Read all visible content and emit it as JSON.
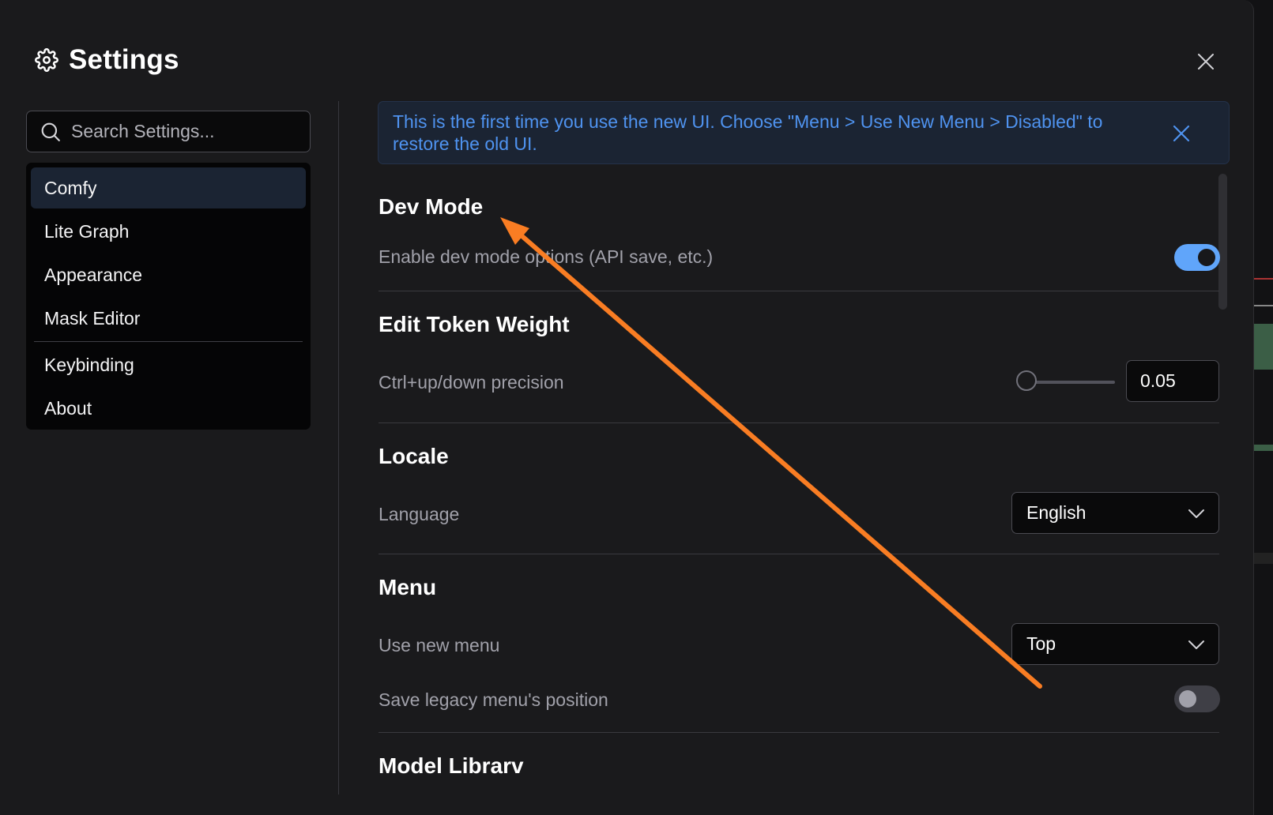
{
  "dialog": {
    "title": "Settings",
    "title_icon": "gear-icon",
    "close_icon": "close-icon"
  },
  "sidebar": {
    "search_placeholder": "Search Settings...",
    "search_icon": "search-icon",
    "items": [
      {
        "label": "Comfy",
        "active": true
      },
      {
        "label": "Lite Graph",
        "active": false
      },
      {
        "label": "Appearance",
        "active": false
      },
      {
        "label": "Mask Editor",
        "active": false
      },
      {
        "label": "Keybinding",
        "active": false
      },
      {
        "label": "About",
        "active": false
      }
    ]
  },
  "banner": {
    "message": "This is the first time you use the new UI. Choose \"Menu > Use New Menu > Disabled\" to restore the old UI.",
    "close_icon": "close-icon",
    "color": "#4f93f0"
  },
  "sections": {
    "dev_mode": {
      "title": "Dev Mode",
      "enable_label": "Enable dev mode options (API save, etc.)",
      "enabled": true
    },
    "edit_token_weight": {
      "title": "Edit Token Weight",
      "precision_label": "Ctrl+up/down precision",
      "precision_value": "0.05",
      "slider_fraction": 0.0
    },
    "locale": {
      "title": "Locale",
      "language_label": "Language",
      "language_value": "English"
    },
    "menu": {
      "title": "Menu",
      "use_new_menu_label": "Use new menu",
      "use_new_menu_value": "Top",
      "save_legacy_label": "Save legacy menu's position",
      "save_legacy_enabled": false
    },
    "model_library": {
      "title": "Model Librarv"
    }
  },
  "colors": {
    "accent": "#60a5fa",
    "annotation_arrow": "#f97d23"
  }
}
